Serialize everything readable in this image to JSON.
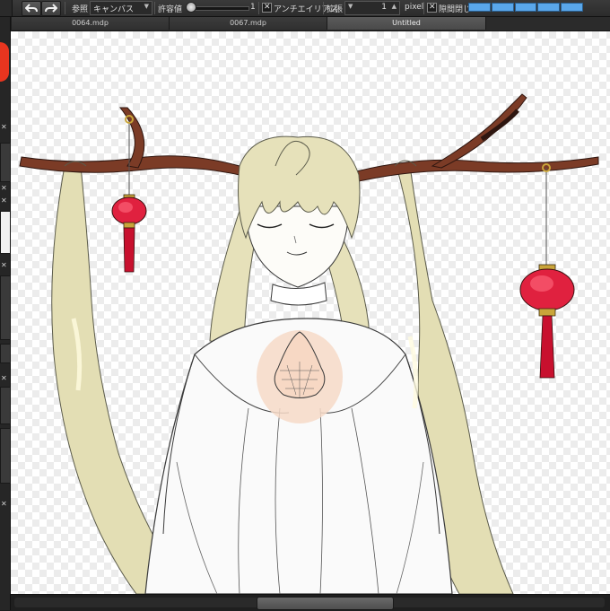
{
  "toolbar": {
    "undo_icon": "undo-arrow-icon",
    "redo_icon": "redo-arrow-icon",
    "reference_label": "参照",
    "reference_value": "キャンバス",
    "tolerance_label": "許容値",
    "tolerance_value": "1",
    "antialias_label": "アンチエイリアス",
    "antialias_checked": true,
    "expand_label": "拡張",
    "expand_value": "1",
    "expand_unit": "pixel",
    "gap_close_label": "隙間閉じ",
    "gap_close_checked": true,
    "gap_close_level": 5,
    "gap_close_max": 5,
    "accent_color": "#5aa7ea"
  },
  "tabs": [
    {
      "label": "0064.mdp",
      "active": false
    },
    {
      "label": "0067.mdp",
      "active": false
    },
    {
      "label": "Untitled",
      "active": true
    }
  ],
  "canvas": {
    "background": "transparent-checkerboard",
    "colors": {
      "hair": "#e3deb4",
      "antler": "#7b3b26",
      "lantern": "#e0213f",
      "lantern_gold": "#c9a53a",
      "skin": "#f6d9c7"
    }
  },
  "scrollbar": {
    "position_fraction": 0.41,
    "visible_fraction": 0.23
  }
}
